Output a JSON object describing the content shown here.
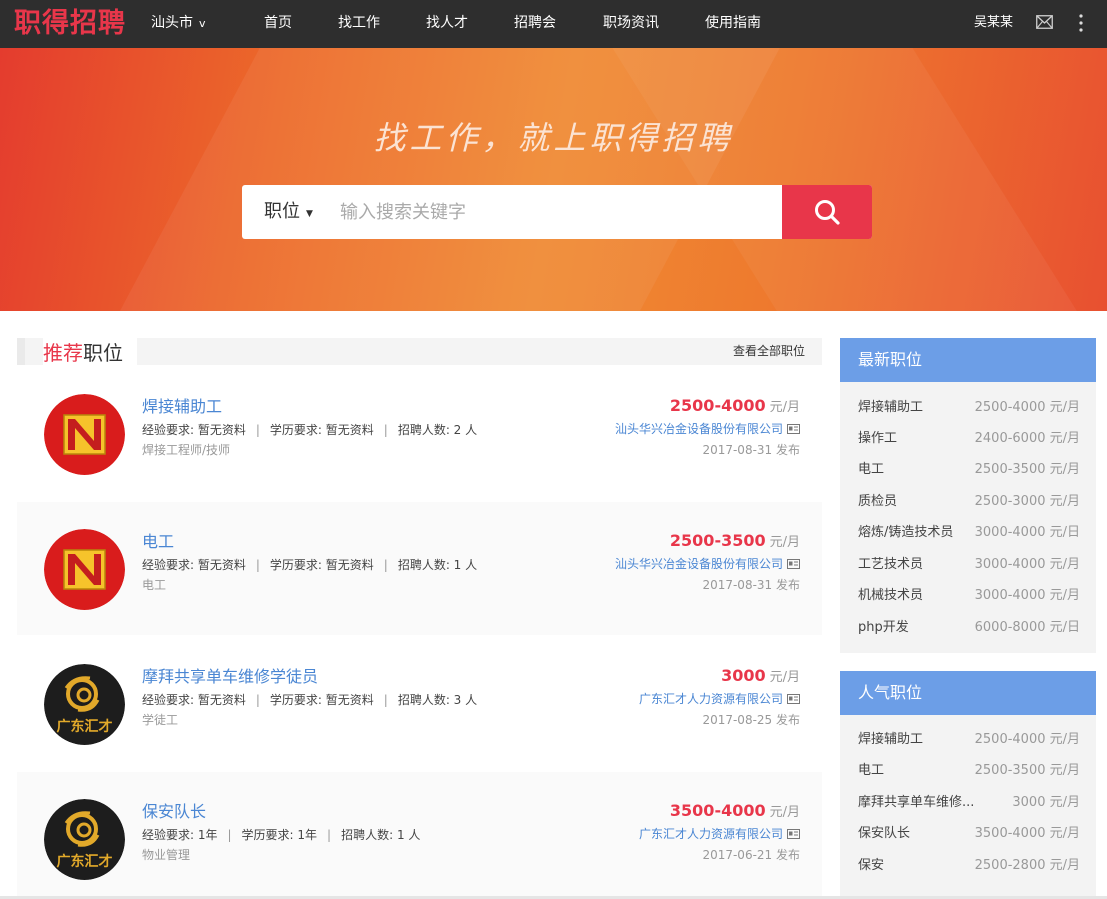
{
  "nav": {
    "logo": "职得招聘",
    "city": "汕头市",
    "items": [
      "首页",
      "找工作",
      "找人才",
      "招聘会",
      "职场资讯",
      "使用指南"
    ],
    "user": "吴某某"
  },
  "hero": {
    "slogan": "找工作，就上职得招聘",
    "search_type": "职位",
    "search_placeholder": "输入搜索关键字"
  },
  "section": {
    "title_highlight": "推荐",
    "title_rest": "职位",
    "view_all": "查看全部职位"
  },
  "jobs": [
    {
      "title": "焊接辅助工",
      "exp_label": "经验要求: 暂无资料",
      "edu_label": "学历要求: 暂无资料",
      "hire_label": "招聘人数: 2 人",
      "category": "焊接工程师/技师",
      "salary": "2500-4000",
      "unit": "元/月",
      "company": "汕头华兴冶金设备股份有限公司",
      "date": "2017-08-31 发布",
      "logo": "ni-red"
    },
    {
      "title": "电工",
      "exp_label": "经验要求: 暂无资料",
      "edu_label": "学历要求: 暂无资料",
      "hire_label": "招聘人数: 1 人",
      "category": "电工",
      "salary": "2500-3500",
      "unit": "元/月",
      "company": "汕头华兴冶金设备股份有限公司",
      "date": "2017-08-31 发布",
      "logo": "ni-red"
    },
    {
      "title": "摩拜共享单车维修学徒员",
      "exp_label": "经验要求: 暂无资料",
      "edu_label": "学历要求: 暂无资料",
      "hire_label": "招聘人数: 3 人",
      "category": "学徒工",
      "salary": "3000",
      "unit": "元/月",
      "company": "广东汇才人力资源有限公司",
      "date": "2017-08-25 发布",
      "logo": "gd-dark",
      "logo_text": "广东汇才"
    },
    {
      "title": "保安队长",
      "exp_label": "经验要求: 1年",
      "edu_label": "学历要求: 1年",
      "hire_label": "招聘人数: 1 人",
      "category": "物业管理",
      "salary": "3500-4000",
      "unit": "元/月",
      "company": "广东汇才人力资源有限公司",
      "date": "2017-06-21 发布",
      "logo": "gd-dark",
      "logo_text": "广东汇才"
    }
  ],
  "latest": {
    "title": "最新职位",
    "rows": [
      {
        "name": "焊接辅助工",
        "salary": "2500-4000 元/月"
      },
      {
        "name": "操作工",
        "salary": "2400-6000 元/月"
      },
      {
        "name": "电工",
        "salary": "2500-3500 元/月"
      },
      {
        "name": "质检员",
        "salary": "2500-3000 元/月"
      },
      {
        "name": "熔炼/铸造技术员",
        "salary": "3000-4000 元/日"
      },
      {
        "name": "工艺技术员",
        "salary": "3000-4000 元/月"
      },
      {
        "name": "机械技术员",
        "salary": "3000-4000 元/月"
      },
      {
        "name": "php开发",
        "salary": "6000-8000 元/日"
      }
    ]
  },
  "popular": {
    "title": "人气职位",
    "rows": [
      {
        "name": "焊接辅助工",
        "salary": "2500-4000 元/月"
      },
      {
        "name": "电工",
        "salary": "2500-3500 元/月"
      },
      {
        "name": "摩拜共享单车维修...",
        "salary": "3000 元/月"
      },
      {
        "name": "保安队长",
        "salary": "3500-4000 元/月"
      },
      {
        "name": "保安",
        "salary": "2500-2800 元/月"
      }
    ]
  },
  "colors": {
    "accent": "#e8364a",
    "link": "#4a86d3",
    "side_head": "#6c9ee7",
    "nav_bg": "#2e2e2e"
  }
}
